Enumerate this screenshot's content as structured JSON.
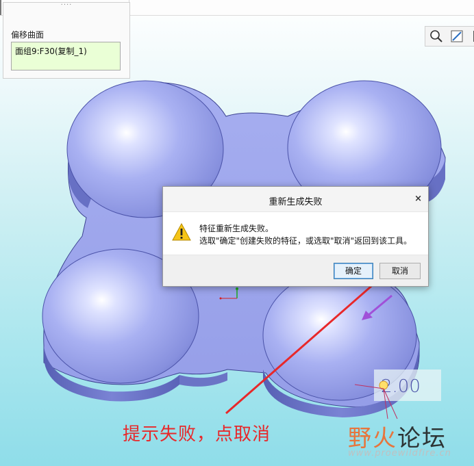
{
  "panel": {
    "grip": "····",
    "label": "偏移曲面",
    "collector_value": "面组9:F30(复制_1)"
  },
  "view_toolbar": {
    "icons": [
      "zoom-icon",
      "sketch-view-icon",
      "more-icon"
    ]
  },
  "dialog": {
    "title": "重新生成失败",
    "close": "×",
    "message_line1": "特征重新生成失败。",
    "message_line2": "选取\"确定\"创建失败的特征，或选取\"取消\"返回到该工具。",
    "ok_label": "确定",
    "cancel_label": "取消"
  },
  "dimension": {
    "value": "2.00"
  },
  "annotation": {
    "caption": "提示失败，点取消",
    "color": "#e8282a"
  },
  "watermark": {
    "text_a": "野火",
    "text_b": "论坛",
    "url": "www.proewildfire.cn"
  },
  "colors": {
    "model": "#a5aef0",
    "model_dark": "#5a63b8",
    "background_bottom": "#8fdde9"
  }
}
